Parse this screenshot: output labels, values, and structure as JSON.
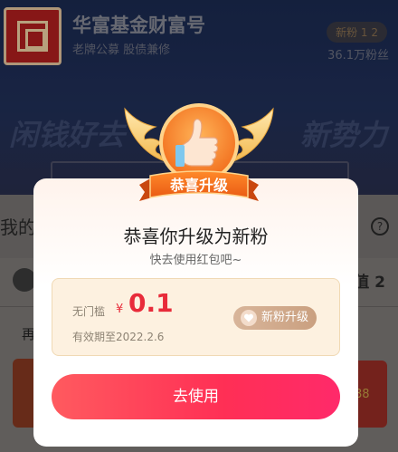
{
  "header": {
    "fund_name": "华富基金财富号",
    "fund_subtitle": "老牌公募 股债兼修",
    "fan_badge": "新粉 1 2",
    "fan_count": "36.1万粉丝",
    "slogan_left": "闲钱好去",
    "slogan_right": "新势力"
  },
  "section": {
    "title": "我的",
    "help_icon": "help-circle-icon",
    "value": "值 2",
    "row_text": "再"
  },
  "modal": {
    "badge_label": "恭喜升级",
    "title": "恭喜你升级为新粉",
    "subtitle": "快去使用红包吧~",
    "coupon": {
      "threshold": "无门槛",
      "currency": "¥",
      "amount": "0.1",
      "expiry": "有效期至2022.2.6",
      "tag_label": "新粉升级",
      "tag_icon": "heart-icon"
    },
    "use_button_label": "去使用"
  },
  "colors": {
    "accent_red": "#ff2f55",
    "coupon_bg": "#fdf1e0",
    "badge_orange": "#f07a28",
    "header_navy": "#1b2b52"
  }
}
